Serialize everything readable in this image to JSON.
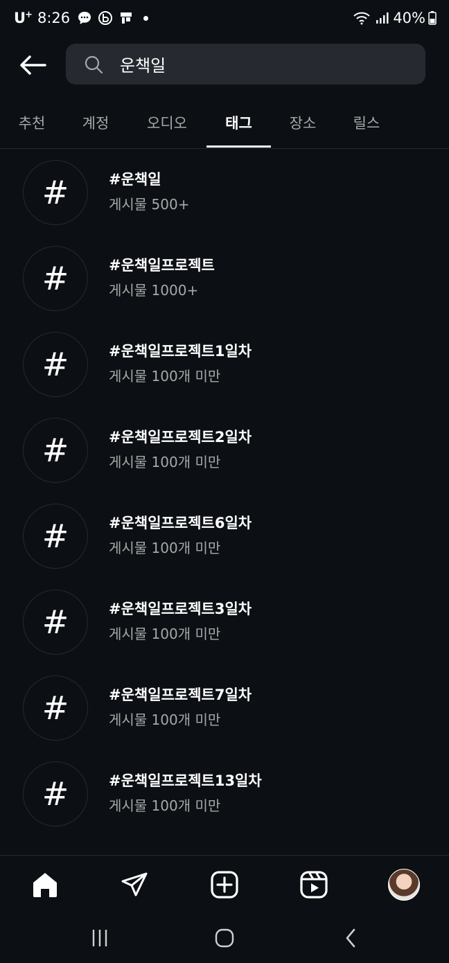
{
  "status_bar": {
    "carrier": "U",
    "carrier_plus": "+",
    "time": "8:26",
    "battery": "40%"
  },
  "search": {
    "query": "운책일"
  },
  "tabs": [
    {
      "label": "추천",
      "active": false
    },
    {
      "label": "계정",
      "active": false
    },
    {
      "label": "오디오",
      "active": false
    },
    {
      "label": "태그",
      "active": true
    },
    {
      "label": "장소",
      "active": false
    },
    {
      "label": "릴스",
      "active": false
    }
  ],
  "results": [
    {
      "icon": "#",
      "tag": "#운책일",
      "count": "게시물 500+"
    },
    {
      "icon": "#",
      "tag": "#운책일프로젝트",
      "count": "게시물 1000+"
    },
    {
      "icon": "#",
      "tag": "#운책일프로젝트1일차",
      "count": "게시물 100개 미만"
    },
    {
      "icon": "#",
      "tag": "#운책일프로젝트2일차",
      "count": "게시물 100개 미만"
    },
    {
      "icon": "#",
      "tag": "#운책일프로젝트6일차",
      "count": "게시물 100개 미만"
    },
    {
      "icon": "#",
      "tag": "#운책일프로젝트3일차",
      "count": "게시물 100개 미만"
    },
    {
      "icon": "#",
      "tag": "#운책일프로젝트7일차",
      "count": "게시물 100개 미만"
    },
    {
      "icon": "#",
      "tag": "#운책일프로젝트13일차",
      "count": "게시물 100개 미만"
    }
  ],
  "bottom_nav": [
    "home-icon",
    "direct-message-icon",
    "create-post-icon",
    "reels-icon",
    "profile-avatar"
  ],
  "colors": {
    "background": "#0c1014",
    "search_bg": "#262a30",
    "secondary_text": "#a8a8a8"
  }
}
